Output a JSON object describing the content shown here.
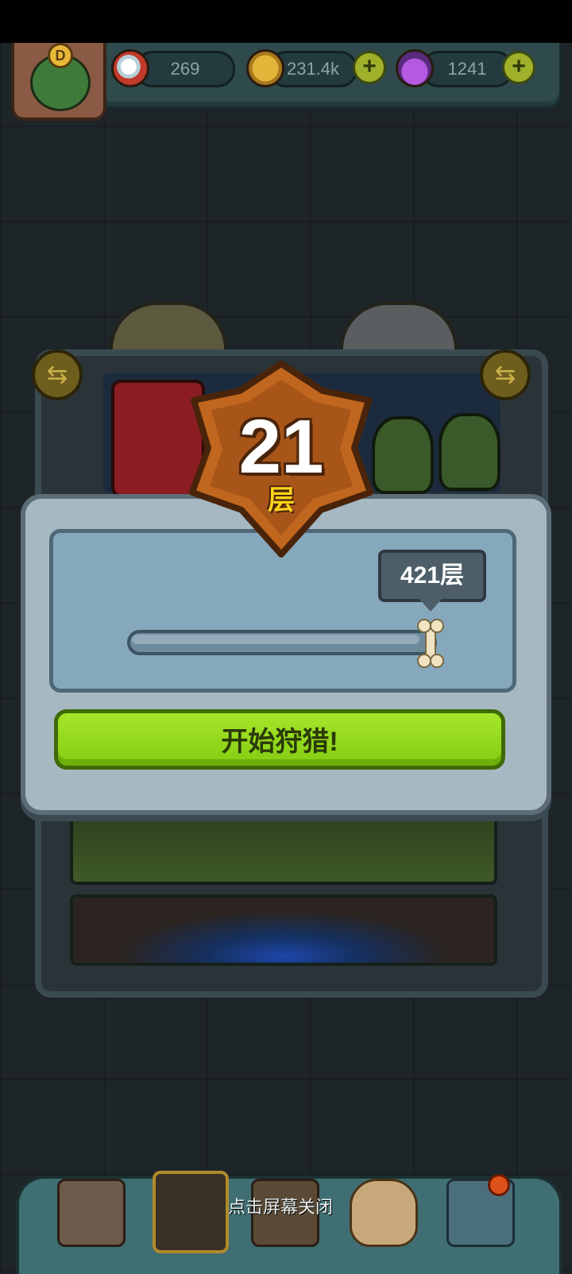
{
  "resources": {
    "eyeballs": "269",
    "coins": "231.4k",
    "potions": "1241"
  },
  "avatar": {
    "badge": "D"
  },
  "floor": {
    "number": "21",
    "unit": "层"
  },
  "slider": {
    "max_label": "421层",
    "progress_fraction": 1.0
  },
  "start_button": {
    "label": "开始狩猎!"
  },
  "close_hint": "点击屏幕关闭",
  "colors": {
    "accent_green": "#8fd81a",
    "badge_orange": "#c0661e",
    "floor_unit_yellow": "#ffd21a"
  }
}
